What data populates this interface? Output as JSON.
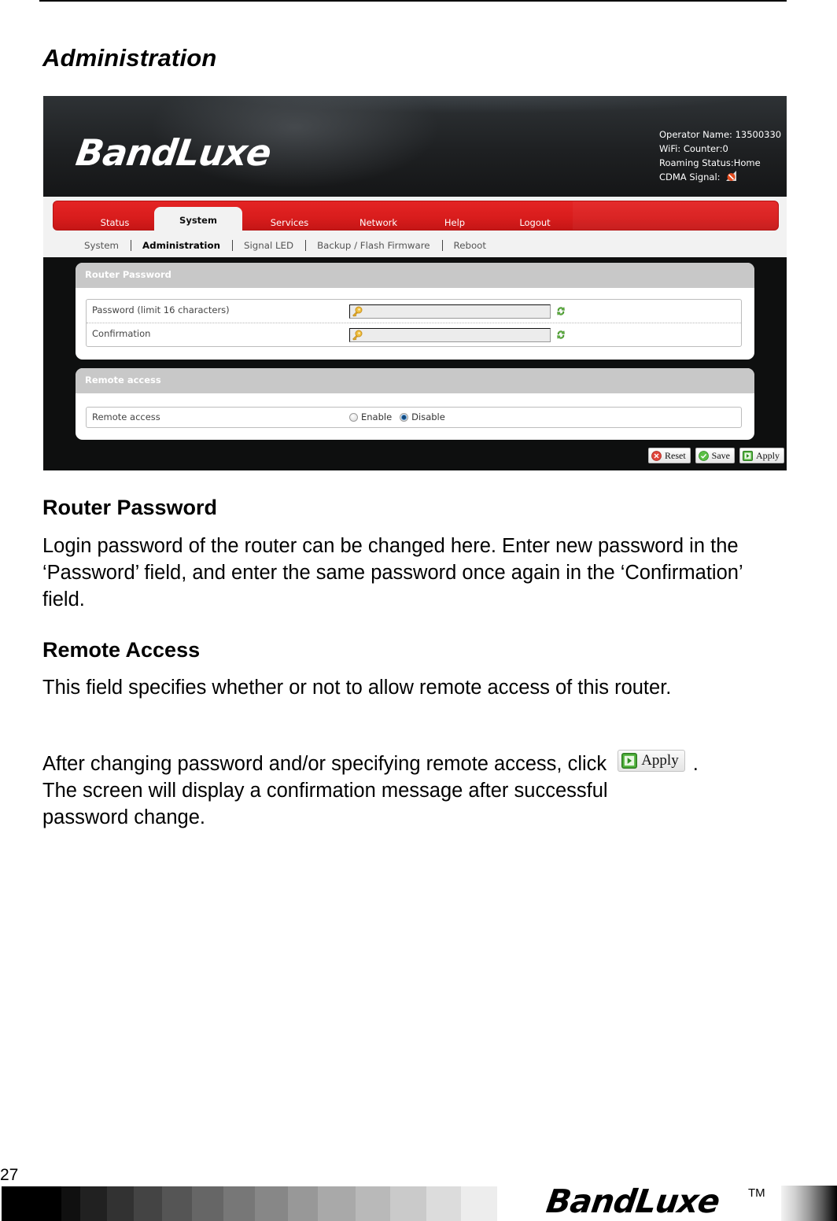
{
  "document": {
    "title": "Administration",
    "page_number": "27"
  },
  "router_ui": {
    "brand": "BandLuxe",
    "status": {
      "operator": "Operator Name: 13500330",
      "wifi": "WiFi: Counter:0",
      "roaming": "Roaming Status:Home",
      "cdma_signal": "CDMA Signal:"
    },
    "menu": {
      "tabs": [
        {
          "label": "Status",
          "active": false
        },
        {
          "label": "System",
          "active": true
        },
        {
          "label": "Services",
          "active": false
        },
        {
          "label": "Network",
          "active": false
        },
        {
          "label": "Help",
          "active": false
        },
        {
          "label": "Logout",
          "active": false
        }
      ]
    },
    "submenu": {
      "items": [
        {
          "label": "System",
          "active": false
        },
        {
          "label": "Administration",
          "active": true
        },
        {
          "label": "Signal LED",
          "active": false
        },
        {
          "label": "Backup / Flash Firmware",
          "active": false
        },
        {
          "label": "Reboot",
          "active": false
        }
      ]
    },
    "router_password": {
      "header": "Router Password",
      "password_label": "Password (limit 16 characters)",
      "password_value": "",
      "confirmation_label": "Confirmation",
      "confirmation_value": ""
    },
    "remote_access": {
      "header": "Remote access",
      "label": "Remote access",
      "options": [
        "Enable",
        "Disable"
      ],
      "selected": "Disable"
    },
    "buttons": {
      "reset": "Reset",
      "save": "Save",
      "apply": "Apply"
    }
  },
  "sections": {
    "router_password": {
      "heading": "Router Password",
      "body": "Login password of the router can be changed here. Enter new password in the ‘Password’ field, and enter the same password once again in the ‘Confirmation’ field."
    },
    "remote_access": {
      "heading": "Remote Access",
      "body": "This field specifies whether or not to allow remote access of this router."
    },
    "after_note": {
      "before_button": "After changing password and/or specifying remote access, click",
      "button_label": "Apply",
      "after_button": ".",
      "continuation": "The screen will display a confirmation message after successful password change."
    }
  },
  "footer": {
    "brand": "BandLuxe",
    "trademark": "TM",
    "grayscale_swatches": [
      "#000000",
      "#101010",
      "#212121",
      "#323232",
      "#444444",
      "#555555",
      "#666666",
      "#777777",
      "#878787",
      "#989898",
      "#a9a9a9",
      "#b9b9b9",
      "#cacaca",
      "#dcdcdc",
      "#ededed"
    ]
  }
}
